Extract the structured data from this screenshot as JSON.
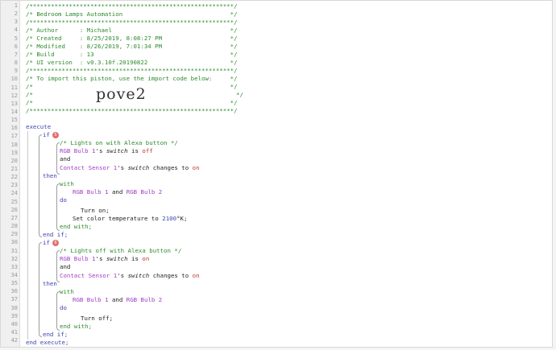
{
  "lines": [
    "1",
    "2",
    "3",
    "4",
    "5",
    "6",
    "7",
    "8",
    "9",
    "10",
    "11",
    "12",
    "13",
    "14",
    "15",
    "16",
    "17",
    "18",
    "19",
    "20",
    "21",
    "22",
    "23",
    "24",
    "25",
    "26",
    "27",
    "28",
    "29",
    "30",
    "31",
    "32",
    "33",
    "34",
    "35",
    "36",
    "37",
    "38",
    "39",
    "40",
    "41",
    "42"
  ],
  "header": {
    "border": "/*********************************************************/",
    "title": "/* Bedroom Lamps Automation                              */",
    "author": "/* Author      : Michael                                 */",
    "created": "/* Created     : 8/25/2019, 8:08:27 PM                   */",
    "modified": "/* Modified    : 8/26/2019, 7:01:34 PM                   */",
    "build": "/* Build       : 13                                      */",
    "ui_version": "/* UI version  : v0.3.10f.20190822                       */",
    "import_note": "/* To import this piston, use the import code below:     */",
    "blank": "/*                                                       */",
    "blank_left": "/*",
    "blank_right": "*/",
    "import_code": "pove2"
  },
  "code": {
    "execute": "execute",
    "if": "if",
    "if_badge": "5",
    "if2_badge": "6",
    "comment1": "/* Lights on with Alexa button */",
    "comment2": "/* Lights off with Alexa button */",
    "bulb1": "RGB Bulb 1",
    "bulb2": "RGB Bulb 2",
    "sensor": "Contact Sensor 1",
    "possessive": "'s ",
    "switch": "switch",
    "is": " is ",
    "off": "off",
    "on": "on",
    "and": "and",
    "changes_to": " changes to ",
    "then": "then",
    "with": "with",
    "and_mid": " and ",
    "do": "do",
    "turn_on": "Turn on;",
    "set_color_pre": "Set color temperature to ",
    "temp_value": "2100",
    "temp_unit": "°K;",
    "turn_off": "Turn off;",
    "end_with": "end with;",
    "end_if": "end if;",
    "end_execute": "end execute;"
  }
}
